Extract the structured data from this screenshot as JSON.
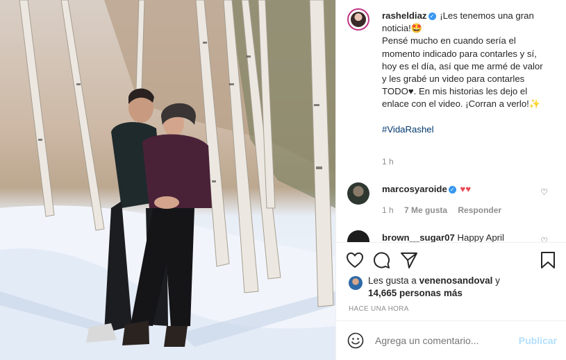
{
  "post": {
    "author": "rasheldiaz",
    "caption_line1": "¡Les tenemos una gran noticia!🤩",
    "caption_body": "Pensé mucho en cuando sería el momento indicado para contarles y sí, hoy es el día, así que me armé de valor y les grabé un video para contarles TODO♥. En mis historias les dejo el enlace con el video. ¡Corran a verlo!✨",
    "hashtag": "#VidaRashel",
    "time": "1 h"
  },
  "comments": [
    {
      "user": "marcosyaroide",
      "text": "♥♥",
      "time": "1 h",
      "likes": "7 Me gusta",
      "reply": "Responder"
    },
    {
      "user": "brown__sugar07",
      "text": "Happy April"
    }
  ],
  "likes": {
    "prefix": "Les gusta a",
    "user": "venenosandoval",
    "conj": "y",
    "count": "14,665 personas más"
  },
  "timestamp": "HACE UNA HORA",
  "comment_box": {
    "placeholder": "Agrega un comentario...",
    "publish": "Publicar"
  },
  "icons": {
    "verified": "verified-badge-icon",
    "like": "heart-icon",
    "comment": "comment-bubble-icon",
    "share": "paper-plane-icon",
    "save": "bookmark-icon",
    "emoji": "smiley-icon"
  }
}
